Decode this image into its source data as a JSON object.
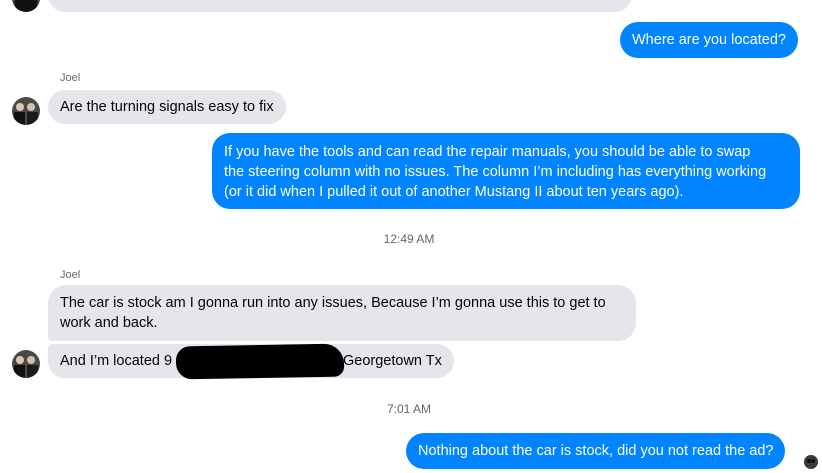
{
  "conversation": {
    "messages": [
      {
        "id": "m1",
        "sender": "me",
        "text": "Where are you located?"
      },
      {
        "id": "m2",
        "sender": "Joel",
        "sender_label": "Joel",
        "text": "Are the turning signals easy to fix"
      },
      {
        "id": "m3",
        "sender": "me",
        "lines": [
          "If you have the tools and can read the repair manuals, you should be able to swap",
          "the steering column with no issues. The column I’m including has everything working",
          "(or it did when I pulled it out of another Mustang II about ten years ago)."
        ]
      },
      {
        "id": "t1",
        "type": "timestamp",
        "text": "12:49 AM"
      },
      {
        "id": "m4",
        "sender": "Joel",
        "sender_label": "Joel",
        "lines": [
          "The car is stock am I gonna run into any issues, Because I’m gonna use this to get to",
          "work and back."
        ]
      },
      {
        "id": "m5",
        "sender": "Joel",
        "text_before_redaction": "And I’m located 9",
        "text_after_redaction": "Georgetown Tx"
      },
      {
        "id": "t2",
        "type": "timestamp",
        "text": "7:01 AM"
      },
      {
        "id": "m6",
        "sender": "me",
        "text": "Nothing about the car is stock, did you not read the ad?"
      }
    ]
  },
  "icons": {
    "contact_avatar": "profile-photo-avatar",
    "seen_indicator": "seen-avatar"
  },
  "colors": {
    "outgoing_bubble": "#0084ff",
    "incoming_bubble": "#e4e6eb",
    "meta_text": "#65676b"
  }
}
